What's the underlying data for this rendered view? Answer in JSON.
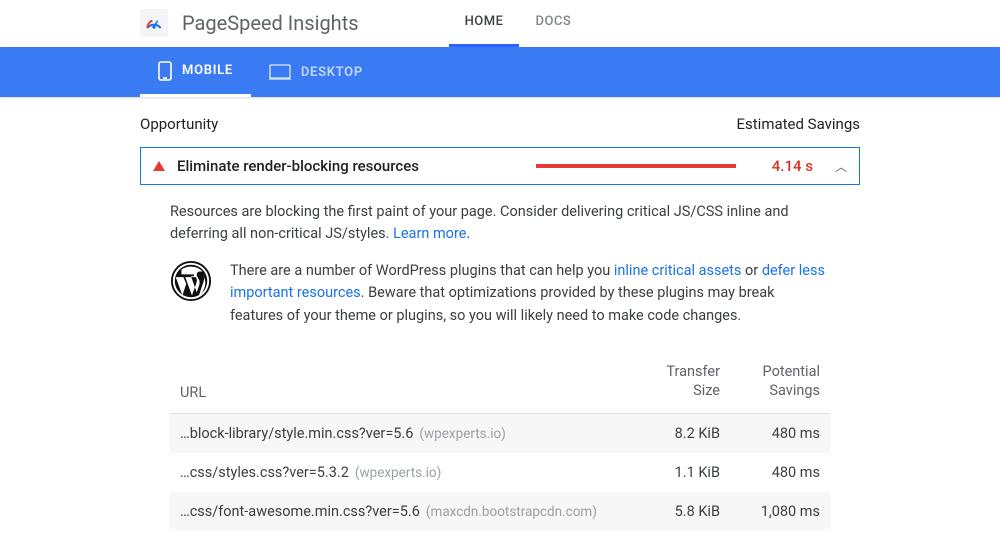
{
  "header": {
    "brand": "PageSpeed Insights",
    "tabs": {
      "home": "HOME",
      "docs": "DOCS"
    }
  },
  "devices": {
    "mobile": "MOBILE",
    "desktop": "DESKTOP"
  },
  "section": {
    "opportunity": "Opportunity",
    "est_savings": "Estimated Savings"
  },
  "opp": {
    "title": "Eliminate render-blocking resources",
    "value": "4.14 s",
    "bar_pct": 100
  },
  "desc": {
    "t1": "Resources are blocking the first paint of your page. Consider delivering critical JS/CSS inline and deferring all non-critical JS/styles. ",
    "learn_more": "Learn more",
    "period": "."
  },
  "wp": {
    "t1": "There are a number of WordPress plugins that can help you ",
    "link1": "inline critical assets",
    "t2": " or ",
    "link2": "defer less important resources",
    "t3": ". Beware that optimizations provided by these plugins may break features of your theme or plugins, so you will likely need to make code changes."
  },
  "table": {
    "h_url": "URL",
    "h_ts1": "Transfer",
    "h_ts2": "Size",
    "h_ps1": "Potential",
    "h_ps2": "Savings",
    "rows": [
      {
        "path": "…block-library/style.min.css?ver=5.6",
        "host": "(wpexperts.io)",
        "ts": "8.2 KiB",
        "ps": "480 ms"
      },
      {
        "path": "…css/styles.css?ver=5.3.2",
        "host": "(wpexperts.io)",
        "ts": "1.1 KiB",
        "ps": "480 ms"
      },
      {
        "path": "…css/font-awesome.min.css?ver=5.6",
        "host": "(maxcdn.bootstrapcdn.com)",
        "ts": "5.8 KiB",
        "ps": "1,080 ms"
      }
    ]
  }
}
